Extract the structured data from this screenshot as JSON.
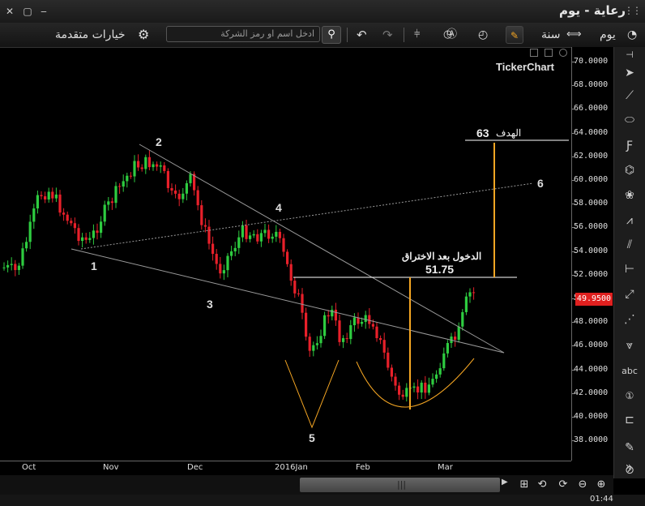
{
  "window": {
    "title": "رعاية - يوم"
  },
  "toolbar": {
    "period_day": "يوم",
    "period_year": "سنة",
    "advanced_options": "خيارات متقدمة",
    "search_placeholder": "ادخل اسم او رمز الشركة"
  },
  "chart": {
    "watermark": "TickerChart",
    "last_price": "49.9500",
    "target_label": "الهدف",
    "target_value": "63",
    "entry_label": "الدخول بعد الاختراق",
    "entry_value": "51.75",
    "point_labels": [
      "1",
      "2",
      "3",
      "4",
      "5",
      "6"
    ]
  },
  "price_axis": {
    "ticks": [
      "70.0000",
      "68.0000",
      "66.0000",
      "64.0000",
      "62.0000",
      "60.0000",
      "58.0000",
      "56.0000",
      "54.0000",
      "52.0000",
      "50.0000",
      "48.0000",
      "46.0000",
      "44.0000",
      "42.0000",
      "40.0000",
      "38.0000"
    ]
  },
  "time_axis": {
    "ticks": [
      "Oct",
      "Nov",
      "Dec",
      "2016Jan",
      "Feb",
      "Mar"
    ]
  },
  "status": {
    "time": "01:44"
  },
  "colors": {
    "up": "#2ecc40",
    "down": "#e8202a",
    "annotation": "#f5a623",
    "trendline": "#9a9a9a",
    "price_badge": "#e0201f"
  }
}
